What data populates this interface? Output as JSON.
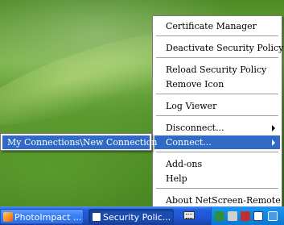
{
  "context_menu": {
    "items": [
      {
        "label": "Certificate Manager"
      },
      {
        "label": "Deactivate Security Policy"
      },
      {
        "label": "Reload Security Policy"
      },
      {
        "label": "Remove Icon"
      },
      {
        "label": "Log Viewer"
      },
      {
        "label": "Disconnect..."
      },
      {
        "label": "Connect..."
      },
      {
        "label": "Add-ons"
      },
      {
        "label": "Help"
      },
      {
        "label": "About NetScreen-Remote"
      }
    ],
    "highlighted": "Connect..."
  },
  "submenu": {
    "items": [
      {
        "label": "My Connections\\New Connection"
      }
    ]
  },
  "taskbar": {
    "buttons": [
      {
        "label": "PhotoImpact ...",
        "icon": "photoimpact-icon",
        "state": "normal"
      },
      {
        "label": "Security Polic...",
        "icon": "netscreen-icon",
        "state": "active"
      }
    ],
    "tray_icons": [
      "network-icon",
      "speaker-icon",
      "shield-icon",
      "netscreen-tray-icon",
      "keyboard-icon"
    ]
  },
  "colors": {
    "highlight": "#316ac5",
    "taskbar": "#245edb",
    "tray": "#0f8ae3"
  }
}
